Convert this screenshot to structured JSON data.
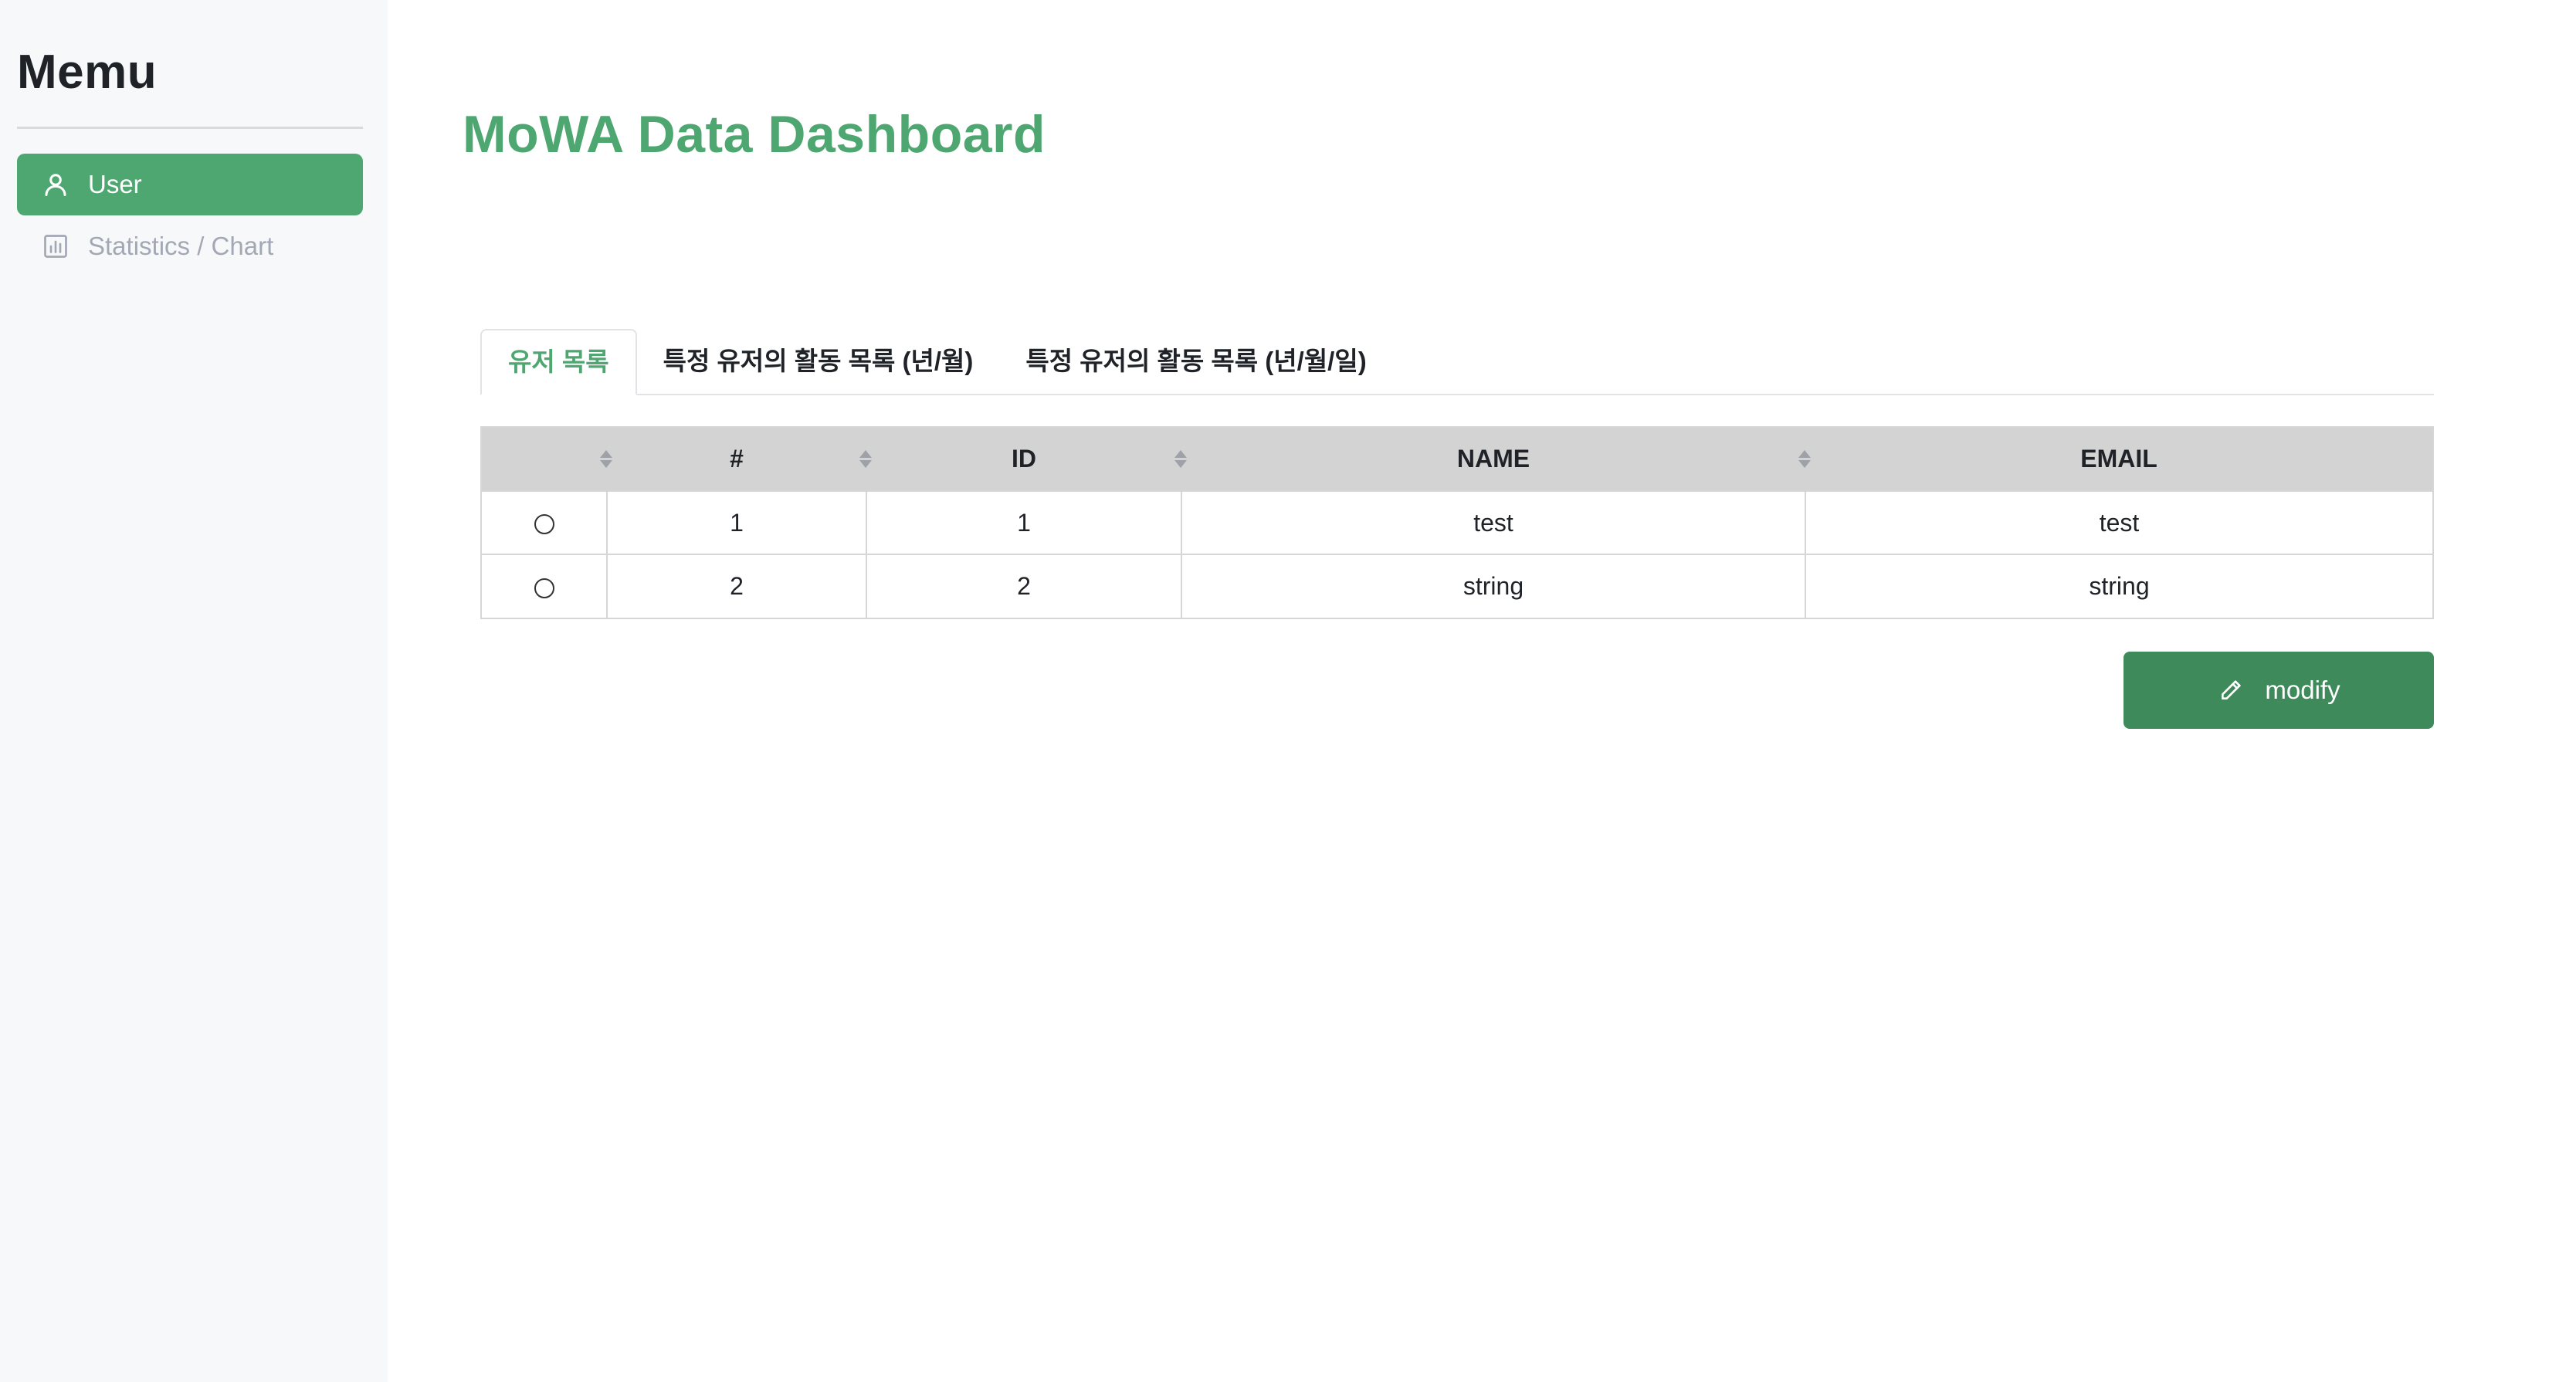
{
  "sidebar": {
    "title": "Memu",
    "items": [
      {
        "label": "User",
        "icon": "user-icon",
        "active": true
      },
      {
        "label": "Statistics / Chart",
        "icon": "bar-chart-icon",
        "active": false
      }
    ]
  },
  "header": {
    "title": "MoWA Data Dashboard"
  },
  "tabs": [
    {
      "label": "유저 목록",
      "active": true
    },
    {
      "label": "특정 유저의 활동 목록 (년/월)",
      "active": false
    },
    {
      "label": "특정 유저의 활동 목록 (년/월/일)",
      "active": false
    }
  ],
  "table": {
    "headers": [
      "",
      "#",
      "ID",
      "NAME",
      "EMAIL"
    ],
    "rows": [
      {
        "index": "1",
        "id": "1",
        "name": "test",
        "email": "test"
      },
      {
        "index": "2",
        "id": "2",
        "name": "string",
        "email": "string"
      }
    ]
  },
  "actions": {
    "modify_label": "modify",
    "modify_icon": "pencil-icon"
  },
  "colors": {
    "accent": "#4ea771",
    "button": "#3e8a5b",
    "sidebar_bg": "#f7f8fa",
    "table_header_bg": "#d3d3d3"
  }
}
